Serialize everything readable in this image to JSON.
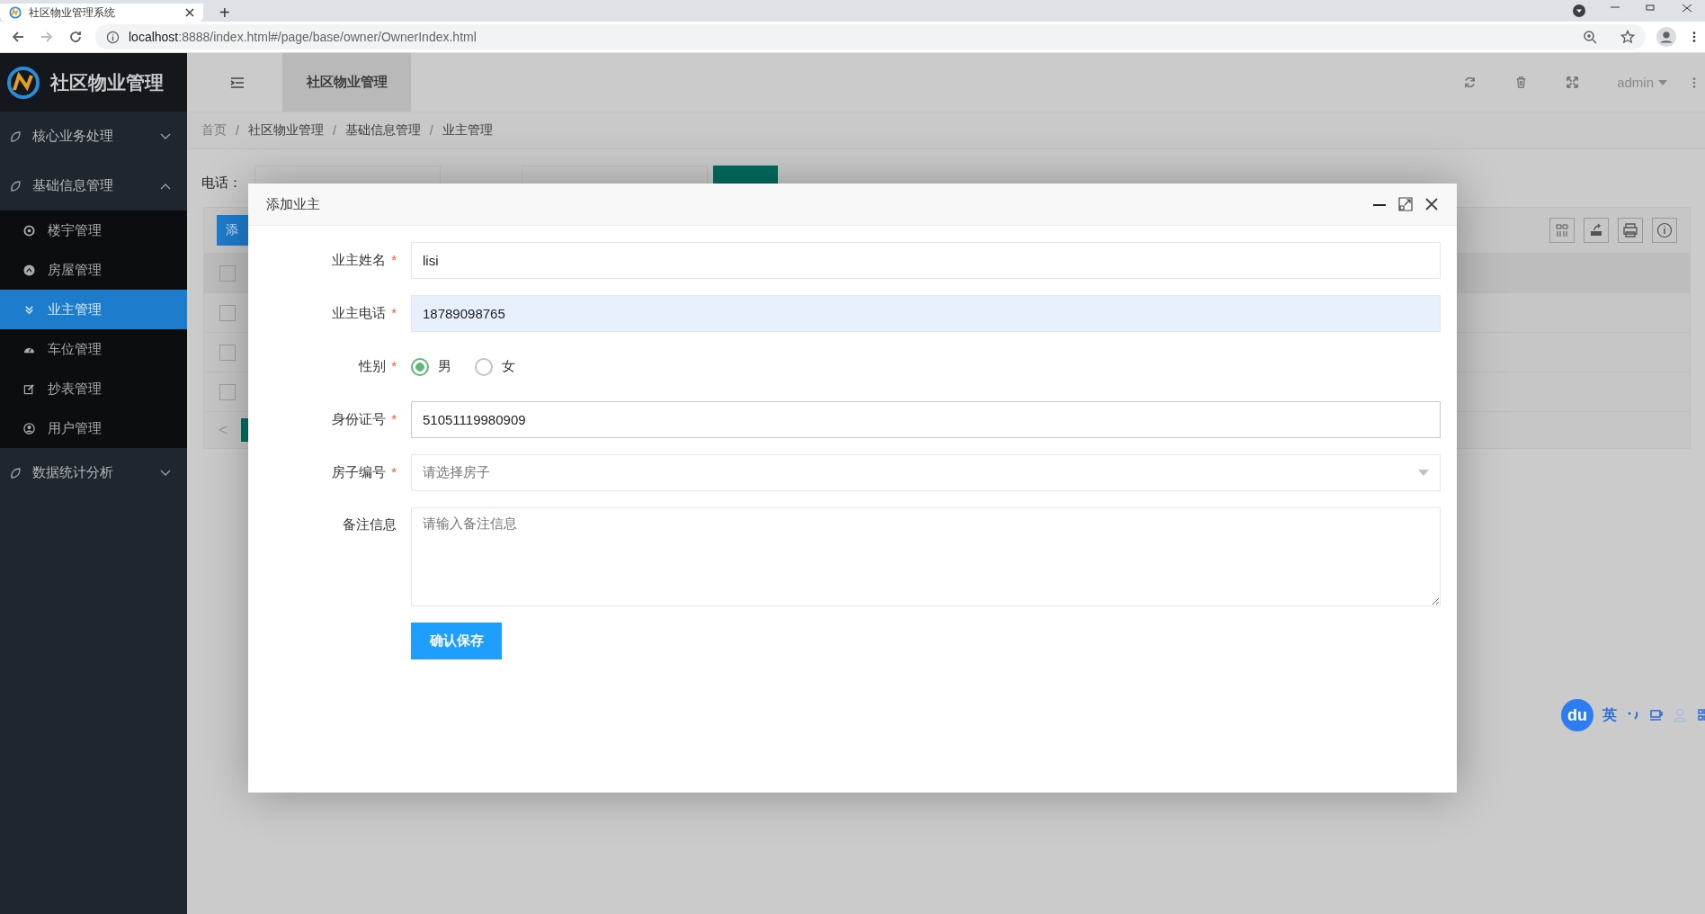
{
  "browser": {
    "tab_title": "社区物业管理系统",
    "new_tab": "+",
    "url_host": "localhost",
    "url_rest": ":8888/index.html#/page/base/owner/OwnerIndex.html"
  },
  "sidebar": {
    "logo_text": "社区物业管理",
    "menus": [
      {
        "label": "核心业务处理",
        "expanded": false
      },
      {
        "label": "基础信息管理",
        "expanded": true,
        "children": [
          {
            "label": "楼宇管理",
            "selected": false
          },
          {
            "label": "房屋管理",
            "selected": false
          },
          {
            "label": "业主管理",
            "selected": true
          },
          {
            "label": "车位管理",
            "selected": false
          },
          {
            "label": "抄表管理",
            "selected": false
          },
          {
            "label": "用户管理",
            "selected": false
          }
        ]
      },
      {
        "label": "数据统计分析",
        "expanded": false
      }
    ]
  },
  "header": {
    "tab": "社区物业管理",
    "user": "admin"
  },
  "breadcrumb": {
    "items": [
      "首页",
      "社区物业管理",
      "基础信息管理",
      "业主管理"
    ],
    "separators": [
      "/",
      "/",
      "/"
    ]
  },
  "search": {
    "label": "电话："
  },
  "table": {
    "add_button": "添",
    "rows": [
      {
        "checked": false
      },
      {
        "checked": false
      },
      {
        "checked": false
      },
      {
        "checked": false
      }
    ],
    "prev": "<"
  },
  "modal": {
    "title": "添加业主",
    "fields": [
      {
        "kind": "text",
        "label": "业主姓名",
        "required_mark": "*",
        "value": "lisi",
        "focused": false,
        "autofilled": false
      },
      {
        "kind": "text",
        "label": "业主电话",
        "required_mark": "*",
        "value": "18789098765",
        "focused": false,
        "autofilled": true
      },
      {
        "kind": "radio",
        "label": "性别",
        "required_mark": "*",
        "options": [
          {
            "label": "男",
            "selected": true
          },
          {
            "label": "女",
            "selected": false
          }
        ]
      },
      {
        "kind": "text",
        "label": "身份证号",
        "required_mark": "*",
        "value": "51051119980909",
        "focused": true,
        "autofilled": false
      },
      {
        "kind": "select",
        "label": "房子编号",
        "required_mark": "*",
        "placeholder": "请选择房子"
      },
      {
        "kind": "textarea",
        "label": "备注信息",
        "placeholder": "请输入备注信息"
      }
    ],
    "submit": "确认保存"
  },
  "ime": {
    "logo": "du",
    "mode": "英"
  }
}
